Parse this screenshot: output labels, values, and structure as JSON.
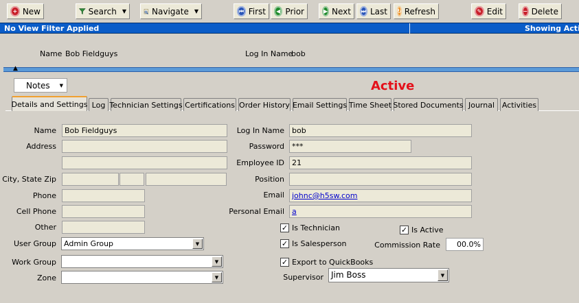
{
  "toolbar": {
    "new": "New",
    "search": "Search",
    "navigate": "Navigate",
    "first": "First",
    "prior": "Prior",
    "next": "Next",
    "last": "Last",
    "refresh": "Refresh",
    "edit": "Edit",
    "delete": "Delete"
  },
  "status_bar": {
    "filter": "No View Filter Applied",
    "showing": "Showing Activ"
  },
  "header": {
    "name_label": "Name",
    "name_value": "Bob Fieldguys",
    "login_label": "Log In Name",
    "login_value": "bob"
  },
  "notes_button": "Notes",
  "record_status": "Active",
  "tabs": [
    {
      "label": "Details and Settings"
    },
    {
      "label": "Log"
    },
    {
      "label": "Technician Settings"
    },
    {
      "label": "Certifications"
    },
    {
      "label": "Order History"
    },
    {
      "label": "Email Settings"
    },
    {
      "label": "Time Sheet"
    },
    {
      "label": "Stored Documents"
    },
    {
      "label": "Journal"
    },
    {
      "label": "Activities"
    }
  ],
  "form": {
    "labels": {
      "name": "Name",
      "address": "Address",
      "city_state_zip": "City, State Zip",
      "phone": "Phone",
      "cell_phone": "Cell Phone",
      "other": "Other",
      "user_group": "User Group",
      "work_group": "Work Group",
      "zone": "Zone",
      "login_name": "Log In Name",
      "password": "Password",
      "employee_id": "Employee ID",
      "position": "Position",
      "email": "Email",
      "personal_email": "Personal Email",
      "commission_rate": "Commission Rate",
      "supervisor": "Supervisor"
    },
    "values": {
      "name": "Bob Fieldguys",
      "address1": "",
      "address2": "",
      "city": "",
      "state": "",
      "zip": "",
      "phone": "",
      "cell_phone": "",
      "other": "",
      "user_group": "Admin Group",
      "work_group": "",
      "zone": "",
      "login_name": "bob",
      "password": "***",
      "employee_id": "21",
      "position": "",
      "email": "johnc@h5sw.com",
      "personal_email": "a",
      "commission_rate": "00.0%",
      "supervisor": "Jim Boss"
    },
    "checkboxes": {
      "is_technician": {
        "label": "Is Technician",
        "checked": true
      },
      "is_salesperson": {
        "label": "Is Salesperson",
        "checked": true
      },
      "export_quickbooks": {
        "label": "Export to QuickBooks",
        "checked": true
      },
      "is_active": {
        "label": "Is Active",
        "checked": true
      }
    }
  },
  "icons": {
    "new": "new-icon",
    "search": "search-icon",
    "navigate": "navigate-icon",
    "first": "first-icon",
    "prior": "prior-icon",
    "next": "next-icon",
    "last": "last-icon",
    "refresh": "refresh-icon",
    "edit": "edit-icon",
    "delete": "delete-icon",
    "dropdown": "chevron-down-icon",
    "checkbox": "checkmark-icon"
  },
  "colors": {
    "status_bar_bg": "#0a5cc8",
    "active_text": "#e4101a",
    "tab_highlight": "#f0a030",
    "link": "#0000cc"
  }
}
